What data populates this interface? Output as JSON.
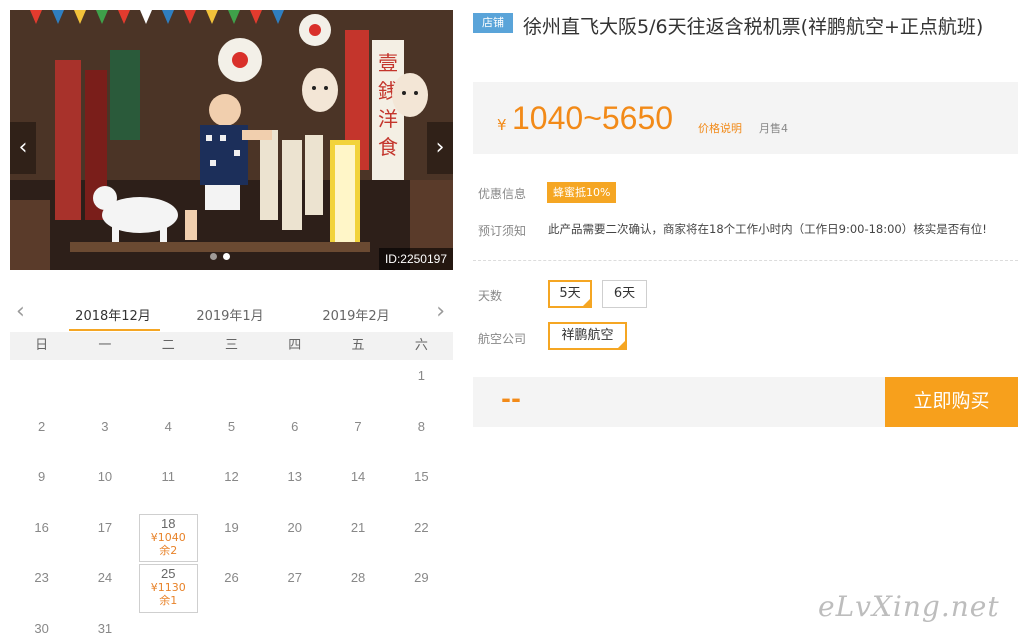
{
  "gallery": {
    "image_id": "ID:2250197",
    "prev_icon": "chevron-left-icon",
    "next_icon": "chevron-right-icon",
    "prev_glyph": "‹",
    "next_glyph": "›",
    "dots": 2,
    "active_dot": 1,
    "sign_texts": [
      "壹",
      "銭",
      "洋",
      "食"
    ]
  },
  "calendar": {
    "prev_glyph": "‹",
    "next_glyph": "›",
    "months": [
      {
        "label": "2018年12月",
        "active": true
      },
      {
        "label": "2019年1月",
        "active": false
      },
      {
        "label": "2019年2月",
        "active": false
      }
    ],
    "weekdays": [
      "日",
      "一",
      "二",
      "三",
      "四",
      "五",
      "六"
    ],
    "weeks": [
      [
        {
          "day": ""
        },
        {
          "day": ""
        },
        {
          "day": ""
        },
        {
          "day": ""
        },
        {
          "day": ""
        },
        {
          "day": ""
        },
        {
          "day": "1"
        }
      ],
      [
        {
          "day": "2"
        },
        {
          "day": "3"
        },
        {
          "day": "4"
        },
        {
          "day": "5"
        },
        {
          "day": "6"
        },
        {
          "day": "7"
        },
        {
          "day": "8"
        }
      ],
      [
        {
          "day": "9"
        },
        {
          "day": "10"
        },
        {
          "day": "11"
        },
        {
          "day": "12"
        },
        {
          "day": "13"
        },
        {
          "day": "14"
        },
        {
          "day": "15"
        }
      ],
      [
        {
          "day": "16"
        },
        {
          "day": "17"
        },
        {
          "day": "18",
          "price": "¥1040",
          "stock": "余2"
        },
        {
          "day": "19"
        },
        {
          "day": "20"
        },
        {
          "day": "21"
        },
        {
          "day": "22"
        }
      ],
      [
        {
          "day": "23"
        },
        {
          "day": "24"
        },
        {
          "day": "25",
          "price": "¥1130",
          "stock": "余1"
        },
        {
          "day": "26"
        },
        {
          "day": "27"
        },
        {
          "day": "28"
        },
        {
          "day": "29"
        }
      ],
      [
        {
          "day": "30"
        },
        {
          "day": "31"
        },
        {
          "day": ""
        },
        {
          "day": ""
        },
        {
          "day": ""
        },
        {
          "day": ""
        },
        {
          "day": ""
        }
      ]
    ]
  },
  "product": {
    "shop_badge": "店铺",
    "title": "徐州直飞大阪5/6天往返含税机票(祥鹏航空+正点航班)",
    "price_symbol": "¥",
    "price_range": "1040~5650",
    "price_note": "价格说明",
    "monthly_sales": "月售4"
  },
  "info": {
    "discount_label": "优惠信息",
    "discount_badge": "蜂蜜抵10%",
    "booking_label": "预订须知",
    "booking_text": "此产品需要二次确认，商家将在18个工作小时内（工作日9:00-18:00）核实是否有位!"
  },
  "options": {
    "days_label": "天数",
    "days": [
      {
        "label": "5天",
        "selected": true
      },
      {
        "label": "6天",
        "selected": false
      }
    ],
    "airline_label": "航空公司",
    "airlines": [
      {
        "label": "祥鹏航空",
        "selected": true
      }
    ]
  },
  "purchase": {
    "placeholder": "--",
    "buy_label": "立即购买"
  },
  "watermark": "eLvXing.net",
  "colors": {
    "accent": "#f5a623",
    "price": "#f28a18",
    "shop_badge": "#5aa4d9"
  }
}
